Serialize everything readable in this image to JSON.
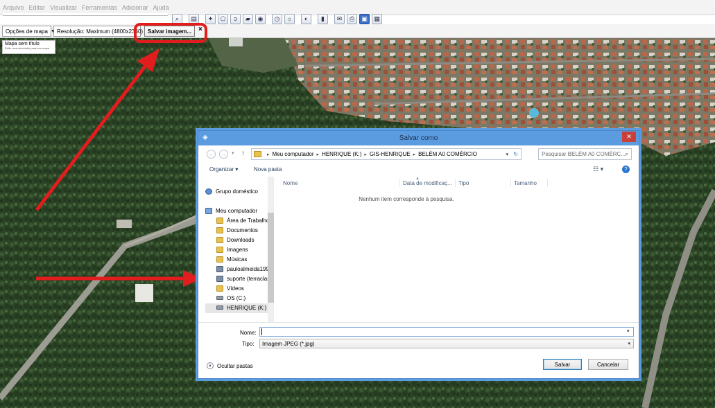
{
  "menu": [
    "Arquivo",
    "Editar",
    "Visualizar",
    "Ferramentas",
    "Adicionar",
    "Ajuda"
  ],
  "toolbar": {
    "icons": [
      "search-icon",
      "sidebar-icon",
      "placemark-icon",
      "polygon-icon",
      "path-icon",
      "overlay-icon",
      "tour-icon",
      "history-icon",
      "sun-icon",
      "planets-icon",
      "ruler-icon",
      "email-icon",
      "print-icon",
      "save-image-icon",
      "map-icon"
    ]
  },
  "mapbar": {
    "map_options": "Opções de mapa",
    "resolution": "Resolução: Maximum (4800x2360)",
    "save_image": "Salvar imagem...",
    "close": "×"
  },
  "map_card": {
    "title": "Mapa sem título",
    "subtitle": "Edite uma descrição para seu mapa"
  },
  "dialog": {
    "title": "Salvar como",
    "close": "✕",
    "breadcrumb": [
      "Meu computador",
      "HENRIQUE (K:)",
      "GIS-HENRIQUE",
      "BELÉM A0 COMÉRCIO"
    ],
    "search_placeholder": "Pesquisar BELÉM A0 COMÉRC...",
    "organize": "Organizar ▾",
    "new_folder": "Nova pasta",
    "nav": [
      {
        "label": "Grupo doméstico",
        "icon": "homegroup-icon"
      },
      {
        "label": "Meu computador",
        "icon": "computer-icon"
      },
      {
        "label": "Área de Trabalho",
        "icon": "folder-icon"
      },
      {
        "label": "Documentos",
        "icon": "folder-icon"
      },
      {
        "label": "Downloads",
        "icon": "folder-icon"
      },
      {
        "label": "Imagens",
        "icon": "folder-icon"
      },
      {
        "label": "Músicas",
        "icon": "folder-icon"
      },
      {
        "label": "pauloalmeida199",
        "icon": "user-folder-icon"
      },
      {
        "label": "suporte (terraclas",
        "icon": "user-folder-icon"
      },
      {
        "label": "Vídeos",
        "icon": "folder-icon"
      },
      {
        "label": "OS (C:)",
        "icon": "drive-icon"
      },
      {
        "label": "HENRIQUE (K:)",
        "icon": "drive-icon"
      }
    ],
    "columns": [
      "Nome",
      "Data de modificaç...",
      "Tipo",
      "Tamanho"
    ],
    "empty_message": "Nenhum item corresponde à pesquisa.",
    "name_label": "Nome:",
    "name_value": "",
    "type_label": "Tipo:",
    "type_value": "Imagem JPEG (*.jpg)",
    "hide_folders": "Ocultar pastas",
    "save": "Salvar",
    "cancel": "Cancelar"
  },
  "colors": {
    "annotation": "#e11d1d",
    "dialog_frame": "#5b9ce0",
    "vegetation": "#2f4a28"
  }
}
